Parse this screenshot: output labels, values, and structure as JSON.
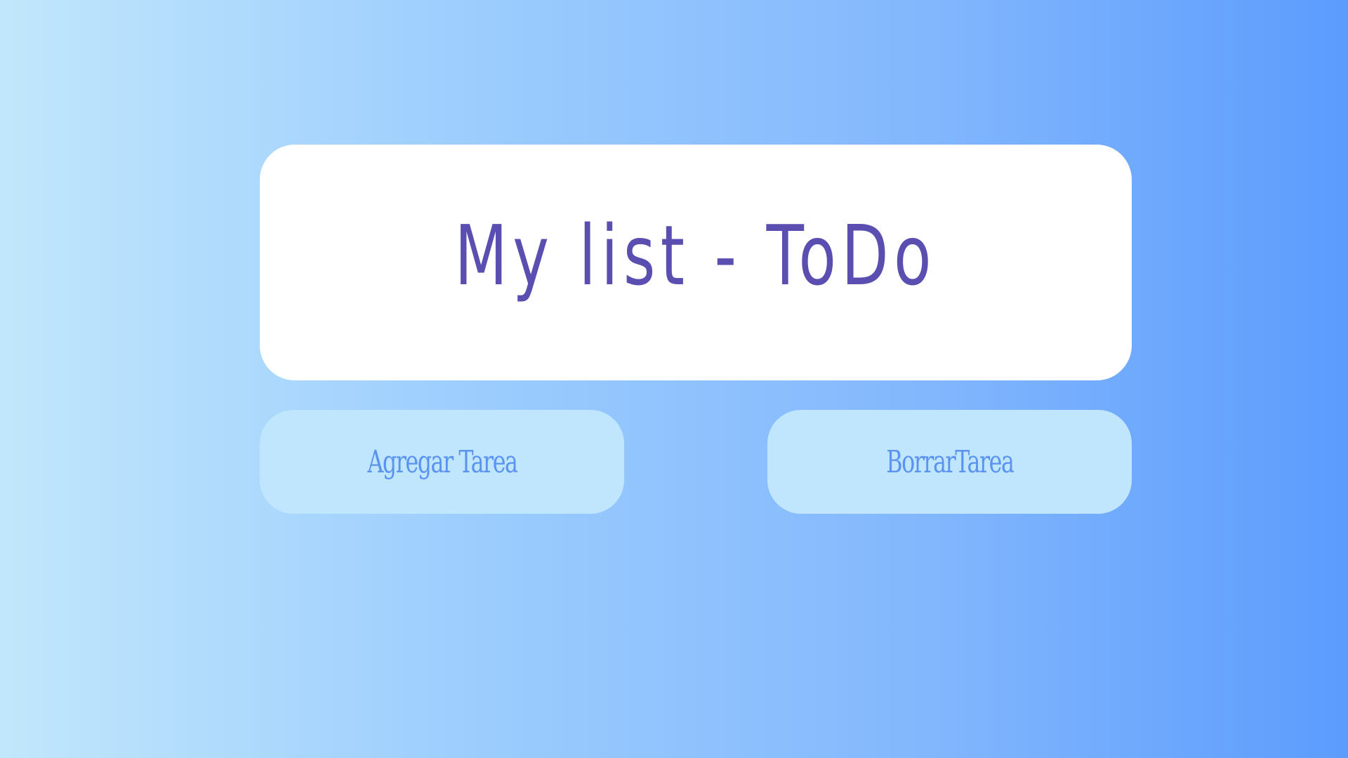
{
  "header": {
    "title": "My list - ToDo"
  },
  "actions": {
    "add_label": "Agregar Tarea",
    "delete_label": "BorrarTarea"
  },
  "colors": {
    "background_start": "#c1e7fc",
    "background_end": "#5c9cfd",
    "card": "#ffffff",
    "title_text": "#5a4fb0",
    "button_bg": "#bfe6fd",
    "button_text": "#5a93f0"
  }
}
